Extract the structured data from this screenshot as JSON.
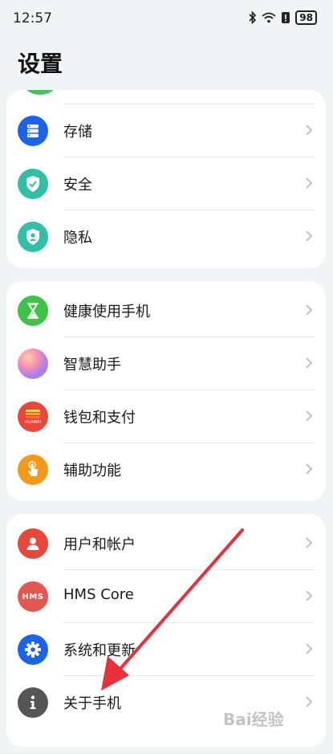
{
  "status": {
    "time": "12:57",
    "battery": "98"
  },
  "page": {
    "title": "设置"
  },
  "group1": {
    "items": [
      {
        "label": "存储",
        "color": "#1b63e8",
        "icon": "storage-icon"
      },
      {
        "label": "安全",
        "color": "#2fbfa4",
        "icon": "shield-check-icon"
      },
      {
        "label": "隐私",
        "color": "#32bfa8",
        "icon": "privacy-shield-icon"
      }
    ]
  },
  "group2": {
    "items": [
      {
        "label": "健康使用手机",
        "color": "#3ec24a",
        "icon": "hourglass-icon"
      },
      {
        "label": "智慧助手",
        "color": "#b585f0",
        "icon": "assistant-orb-icon"
      },
      {
        "label": "钱包和支付",
        "color": "#e8473a",
        "icon": "wallet-icon",
        "badge": "HUAWEI"
      },
      {
        "label": "辅助功能",
        "color": "#f29a18",
        "icon": "hand-pointer-icon"
      }
    ]
  },
  "group3": {
    "items": [
      {
        "label": "用户和帐户",
        "color": "#e8473a",
        "icon": "user-icon"
      },
      {
        "label": "HMS Core",
        "color": "#e2574f",
        "icon": "hms-logo-icon",
        "badge": "HMS"
      },
      {
        "label": "系统和更新",
        "color": "#1b63e8",
        "icon": "gear-icon"
      },
      {
        "label": "关于手机",
        "color": "#555555",
        "icon": "info-icon"
      }
    ]
  },
  "annotation": {
    "color": "#e8303a"
  },
  "watermark": {
    "text": "Bai经验"
  }
}
